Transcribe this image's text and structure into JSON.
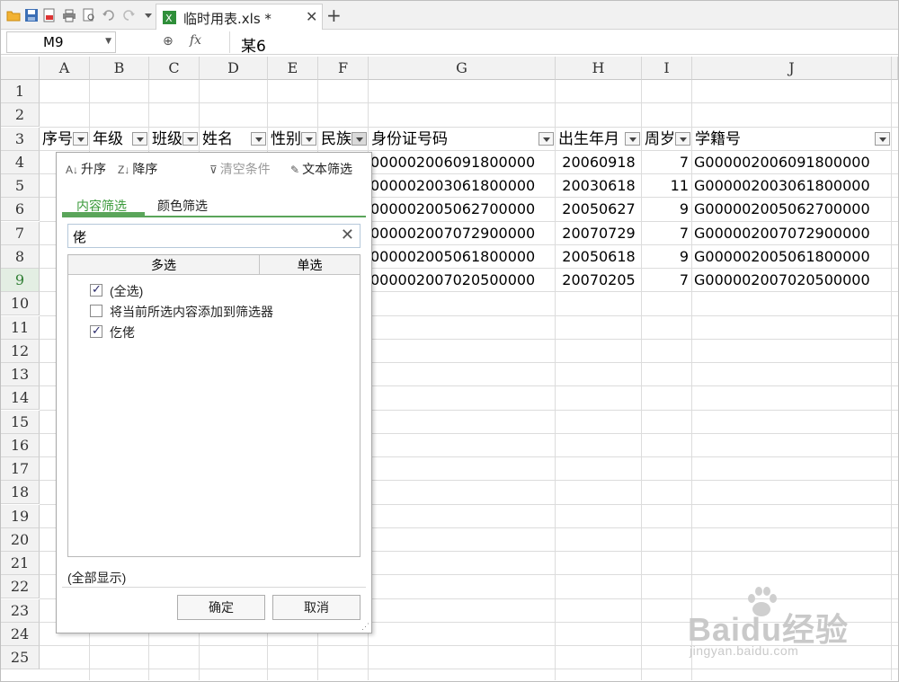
{
  "file_tab": {
    "name": "临时用表.xls *",
    "close": "✕",
    "new": "+"
  },
  "formula_bar": {
    "cell_ref": "M9",
    "fx": "fx",
    "value": "某6"
  },
  "columns": [
    "A",
    "B",
    "C",
    "D",
    "E",
    "F",
    "G",
    "H",
    "I",
    "J"
  ],
  "rows": [
    "1",
    "2",
    "3",
    "4",
    "5",
    "6",
    "7",
    "8",
    "9",
    "10",
    "11",
    "12",
    "13",
    "14",
    "15",
    "16",
    "17",
    "18",
    "19",
    "20",
    "21",
    "22",
    "23",
    "24",
    "25"
  ],
  "selected_row": "9",
  "headers": {
    "A": "序号",
    "B": "年级",
    "C": "班级",
    "D": "姓名",
    "E": "性别",
    "F": "民族",
    "G": "身份证号码",
    "H": "出生年月",
    "I": "周岁",
    "J": "学籍号"
  },
  "data_rows": [
    {
      "id": "000002006091800000",
      "birth": "20060918",
      "age": "7",
      "xj": "G000002006091800000"
    },
    {
      "id": "000002003061800000",
      "birth": "20030618",
      "age": "11",
      "xj": "G000002003061800000"
    },
    {
      "id": "000002005062700000",
      "birth": "20050627",
      "age": "9",
      "xj": "G000002005062700000"
    },
    {
      "id": "000002007072900000",
      "birth": "20070729",
      "age": "7",
      "xj": "G000002007072900000"
    },
    {
      "id": "000002005061800000",
      "birth": "20050618",
      "age": "9",
      "xj": "G000002005061800000"
    },
    {
      "id": "000002007020500000",
      "birth": "20070205",
      "age": "7",
      "xj": "G000002007020500000"
    }
  ],
  "filter_panel": {
    "sort_asc": "升序",
    "sort_desc": "降序",
    "clear": "清空条件",
    "text_filter": "文本筛选",
    "tab_content": "内容筛选",
    "tab_color": "颜色筛选",
    "search_value": "佬",
    "clear_icon": "✕",
    "col_multi": "多选",
    "col_single": "单选",
    "items": [
      {
        "label": "(全选)",
        "checked": true
      },
      {
        "label": "将当前所选内容添加到筛选器",
        "checked": false
      },
      {
        "label": "仡佬",
        "checked": true
      }
    ],
    "show_all": "(全部显示)",
    "ok": "确定",
    "cancel": "取消"
  },
  "watermark": {
    "brand": "Baidu经验",
    "url": "jingyan.baidu.com"
  }
}
